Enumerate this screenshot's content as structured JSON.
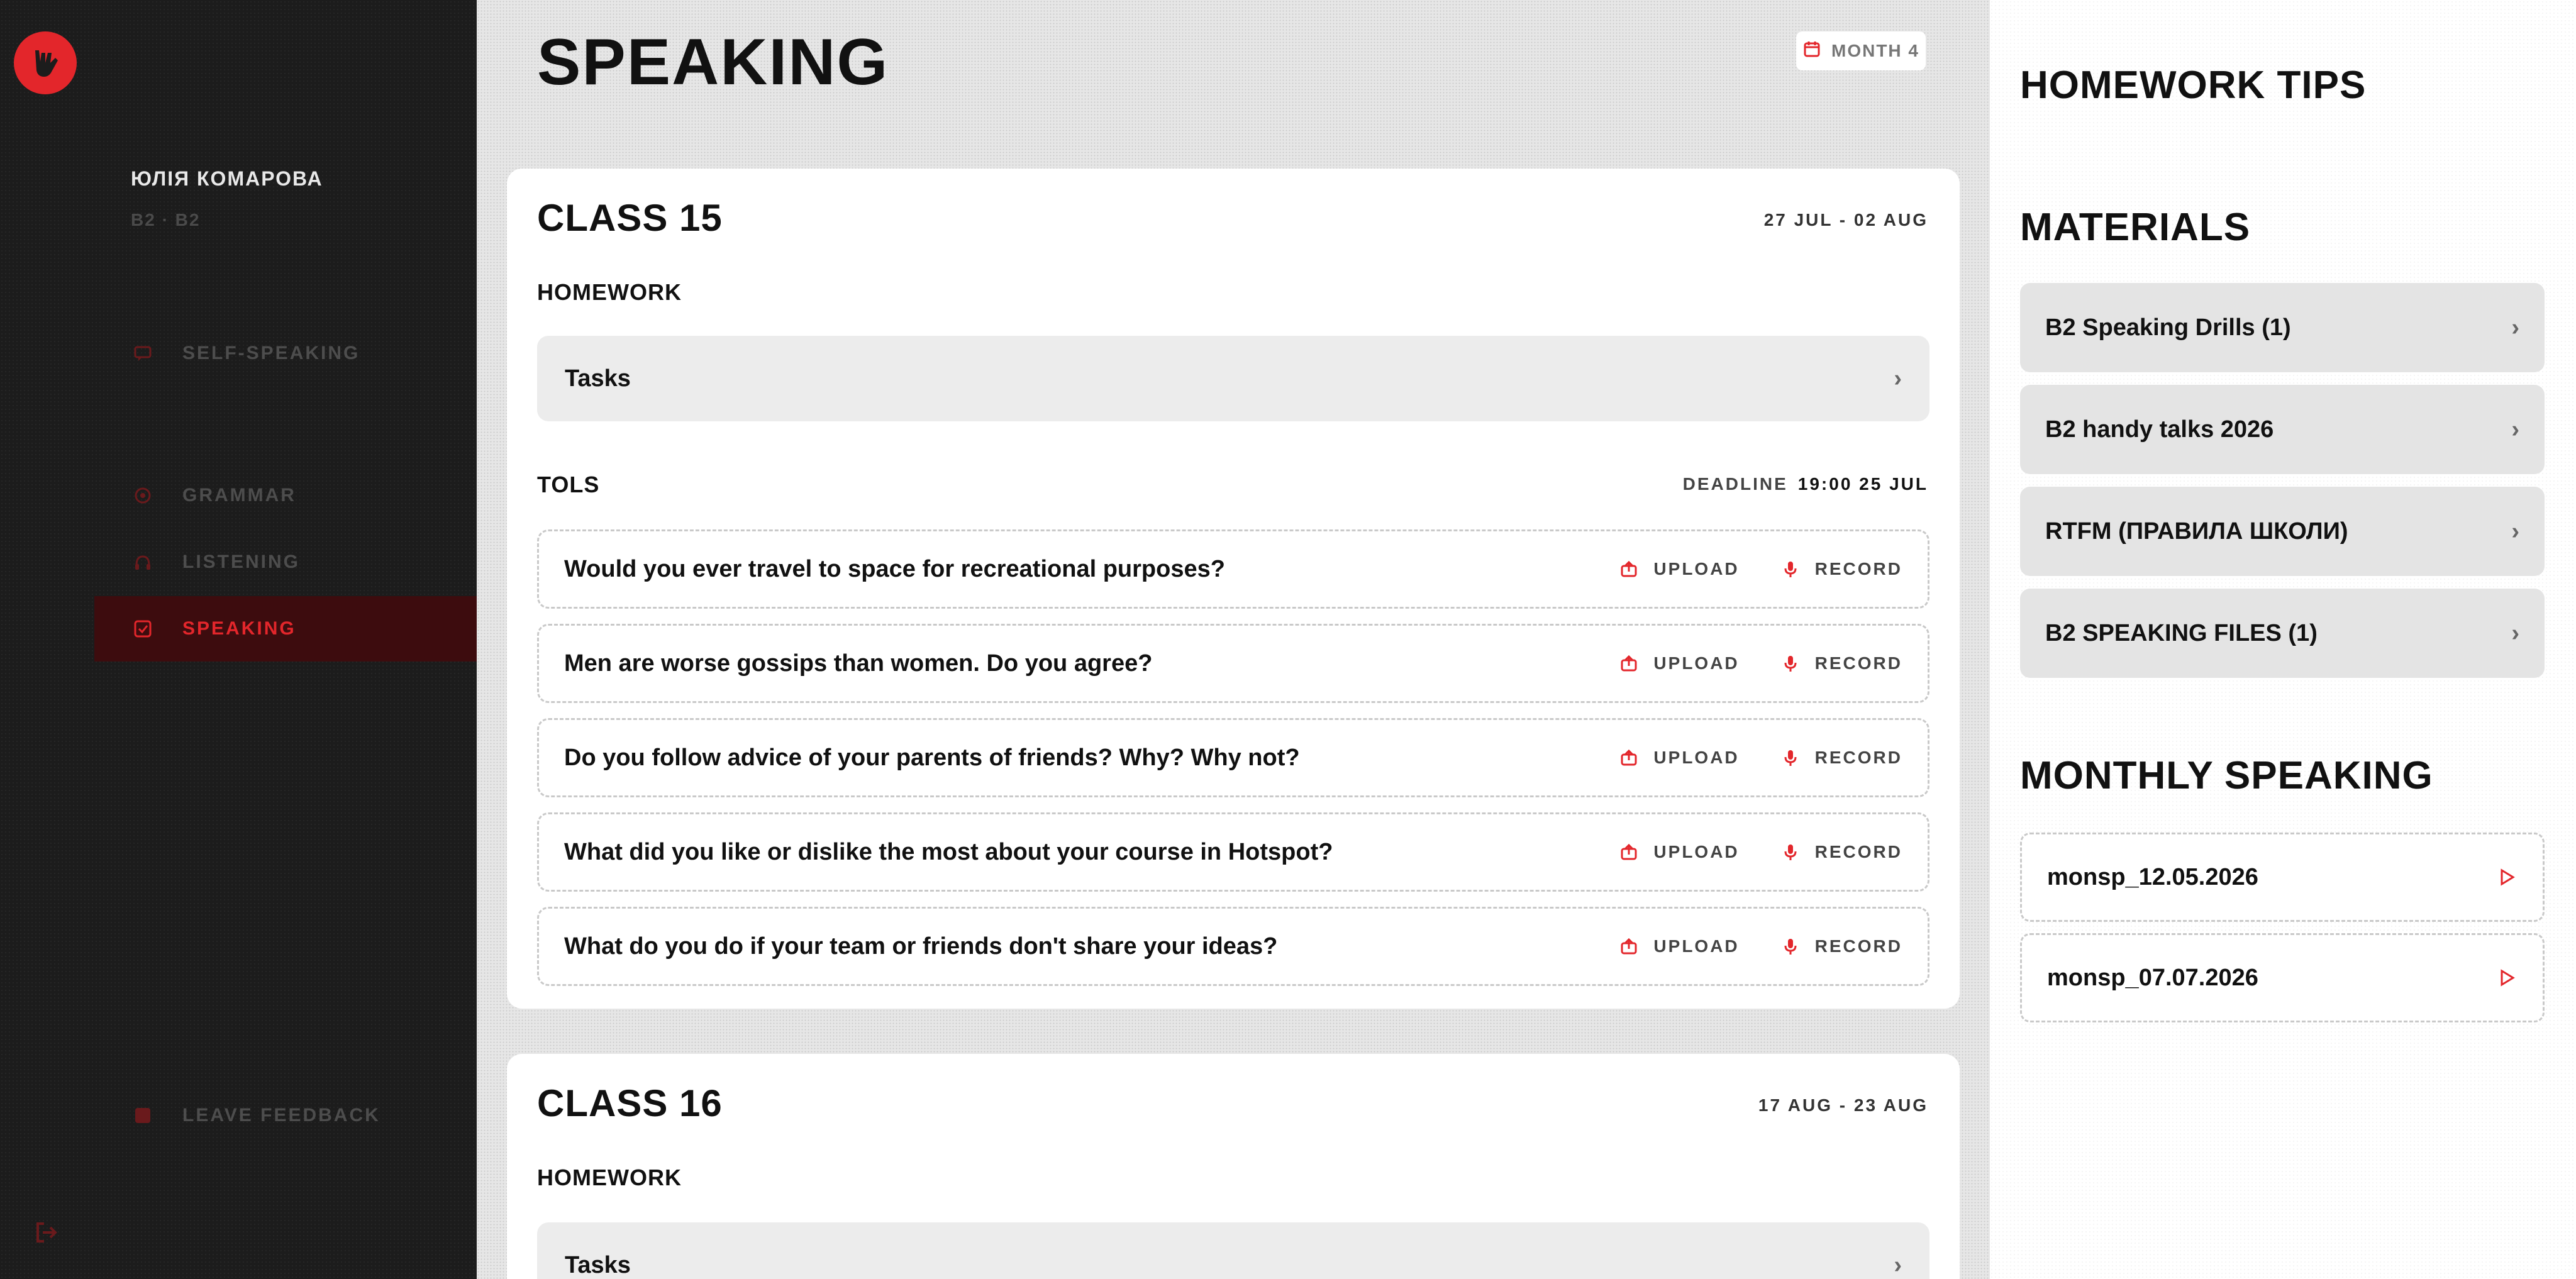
{
  "colors": {
    "accent": "#e3262b",
    "sidebar_bg": "#1c1c1c",
    "main_bg": "#e6e6e6"
  },
  "sidebar": {
    "logo_icon": "hand-rock-icon",
    "user": {
      "name": "ЮЛІЯ КОМАРОВА",
      "level": "B2 · B2"
    },
    "nav": [
      {
        "label": "SELF-SPEAKING",
        "icon": "message-icon"
      },
      {
        "label": "GRAMMAR",
        "icon": "grammar-icon"
      },
      {
        "label": "LISTENING",
        "icon": "headphones-icon"
      },
      {
        "label": "SPEAKING",
        "icon": "speaking-icon"
      }
    ],
    "feedback": {
      "label": "LEAVE FEEDBACK",
      "icon": "feedback-icon"
    },
    "logout_icon": "logout-icon"
  },
  "main": {
    "title": "SPEAKING",
    "month_badge": "MONTH 4",
    "classes": [
      {
        "title": "CLASS 15",
        "dates": "27 JUL - 02 AUG",
        "homework_label": "HOMEWORK",
        "tasks_label": "Tasks",
        "tols_label": "TOLS",
        "deadline_label": "DEADLINE",
        "deadline_value": "19:00 25 JUL",
        "questions": [
          "Would you ever travel to space for recreational purposes?",
          "Men are worse gossips than women. Do you agree?",
          "Do you follow advice of your parents of friends? Why? Why not?",
          "What did you like or dislike the most about your course in Hotspot?",
          "What do you do if your team or friends don't share your ideas?"
        ],
        "upload_label": "UPLOAD",
        "record_label": "RECORD"
      },
      {
        "title": "CLASS 16",
        "dates": "17 AUG - 23 AUG",
        "homework_label": "HOMEWORK",
        "tasks_label": "Tasks"
      }
    ]
  },
  "right": {
    "homework_tips": "HOMEWORK TIPS",
    "materials_title": "MATERIALS",
    "materials": [
      "B2 Speaking Drills (1)",
      "B2 handy talks 2026",
      "RTFM (ПРАВИЛА ШКОЛИ)",
      "B2 SPEAKING FILES (1)"
    ],
    "monthly_title": "MONTHLY SPEAKING",
    "monthly": [
      "monsp_12.05.2026",
      "monsp_07.07.2026"
    ]
  }
}
